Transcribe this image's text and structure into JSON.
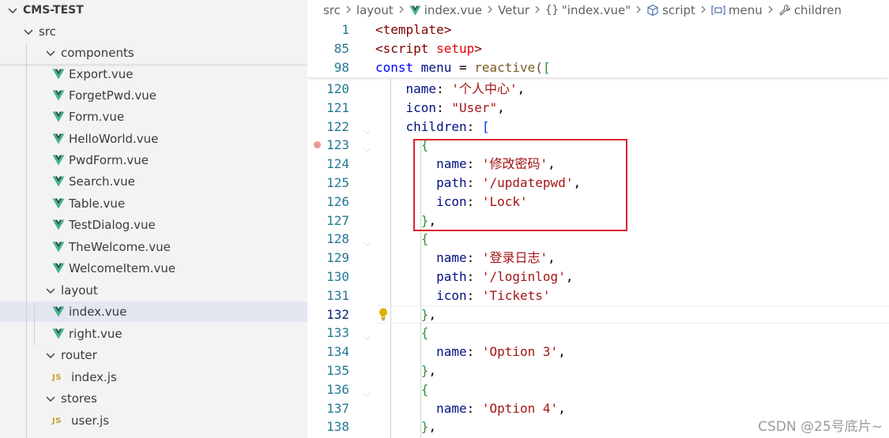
{
  "explorer": {
    "project": "CMS-TEST",
    "items": [
      {
        "label": "src",
        "type": "folder"
      },
      {
        "label": "components",
        "type": "folder"
      },
      {
        "label": "Export.vue",
        "type": "vue"
      },
      {
        "label": "ForgetPwd.vue",
        "type": "vue"
      },
      {
        "label": "Form.vue",
        "type": "vue"
      },
      {
        "label": "HelloWorld.vue",
        "type": "vue"
      },
      {
        "label": "PwdForm.vue",
        "type": "vue"
      },
      {
        "label": "Search.vue",
        "type": "vue"
      },
      {
        "label": "Table.vue",
        "type": "vue"
      },
      {
        "label": "TestDialog.vue",
        "type": "vue"
      },
      {
        "label": "TheWelcome.vue",
        "type": "vue"
      },
      {
        "label": "WelcomeItem.vue",
        "type": "vue"
      },
      {
        "label": "layout",
        "type": "folder"
      },
      {
        "label": "index.vue",
        "type": "vue",
        "selected": true
      },
      {
        "label": "right.vue",
        "type": "vue"
      },
      {
        "label": "router",
        "type": "folder"
      },
      {
        "label": "index.js",
        "type": "js"
      },
      {
        "label": "stores",
        "type": "folder"
      },
      {
        "label": "user.js",
        "type": "js"
      }
    ],
    "js_badge": "JS"
  },
  "breadcrumb": {
    "items": [
      "src",
      "layout",
      "index.vue",
      "Vetur",
      "\"index.vue\"",
      "script",
      "menu",
      "children"
    ],
    "braces": "{}"
  },
  "editor": {
    "sticky_lines": [
      {
        "num": "1",
        "tokens": [
          {
            "t": "<template>",
            "c": "tag"
          }
        ]
      },
      {
        "num": "85",
        "tokens": [
          {
            "t": "<script ",
            "c": "tag"
          },
          {
            "t": "setup",
            "c": "attr"
          },
          {
            "t": ">",
            "c": "tag"
          }
        ]
      },
      {
        "num": "98",
        "tokens": [
          {
            "t": "const ",
            "c": "kw"
          },
          {
            "t": "menu",
            "c": "var"
          },
          {
            "t": " = ",
            "c": "punc"
          },
          {
            "t": "reactive",
            "c": "fn"
          },
          {
            "t": "(",
            "c": "br3"
          },
          {
            "t": "[",
            "c": "br1"
          }
        ]
      }
    ],
    "lines": [
      {
        "num": "120",
        "tokens": [
          {
            "t": "    name",
            "c": "key"
          },
          {
            "t": ": ",
            "c": "punc"
          },
          {
            "t": "'个人中心'",
            "c": "str"
          },
          {
            "t": ",",
            "c": "punc"
          }
        ]
      },
      {
        "num": "121",
        "tokens": [
          {
            "t": "    icon",
            "c": "key"
          },
          {
            "t": ": ",
            "c": "punc"
          },
          {
            "t": "\"User\"",
            "c": "str"
          },
          {
            "t": ",",
            "c": "punc"
          }
        ]
      },
      {
        "num": "122",
        "tokens": [
          {
            "t": "    children",
            "c": "key"
          },
          {
            "t": ": ",
            "c": "punc"
          },
          {
            "t": "[",
            "c": "br2"
          }
        ]
      },
      {
        "num": "123",
        "tokens": [
          {
            "t": "      {",
            "c": "br1"
          }
        ]
      },
      {
        "num": "124",
        "tokens": [
          {
            "t": "        name",
            "c": "key"
          },
          {
            "t": ": ",
            "c": "punc"
          },
          {
            "t": "'修改密码'",
            "c": "str"
          },
          {
            "t": ",",
            "c": "punc"
          }
        ]
      },
      {
        "num": "125",
        "tokens": [
          {
            "t": "        path",
            "c": "key"
          },
          {
            "t": ": ",
            "c": "punc"
          },
          {
            "t": "'/updatepwd'",
            "c": "str"
          },
          {
            "t": ",",
            "c": "punc"
          }
        ]
      },
      {
        "num": "126",
        "tokens": [
          {
            "t": "        icon",
            "c": "key"
          },
          {
            "t": ": ",
            "c": "punc"
          },
          {
            "t": "'Lock'",
            "c": "str"
          }
        ]
      },
      {
        "num": "127",
        "tokens": [
          {
            "t": "      }",
            "c": "br1"
          },
          {
            "t": ",",
            "c": "punc"
          }
        ]
      },
      {
        "num": "128",
        "tokens": [
          {
            "t": "      {",
            "c": "br1"
          }
        ]
      },
      {
        "num": "129",
        "tokens": [
          {
            "t": "        name",
            "c": "key"
          },
          {
            "t": ": ",
            "c": "punc"
          },
          {
            "t": "'登录日志'",
            "c": "str"
          },
          {
            "t": ",",
            "c": "punc"
          }
        ]
      },
      {
        "num": "130",
        "tokens": [
          {
            "t": "        path",
            "c": "key"
          },
          {
            "t": ": ",
            "c": "punc"
          },
          {
            "t": "'/loginlog'",
            "c": "str"
          },
          {
            "t": ",",
            "c": "punc"
          }
        ]
      },
      {
        "num": "131",
        "tokens": [
          {
            "t": "        icon",
            "c": "key"
          },
          {
            "t": ": ",
            "c": "punc"
          },
          {
            "t": "'Tickets'",
            "c": "str"
          }
        ]
      },
      {
        "num": "132",
        "tokens": [
          {
            "t": "      }",
            "c": "br1"
          },
          {
            "t": ",",
            "c": "punc"
          }
        ],
        "active": true
      },
      {
        "num": "133",
        "tokens": [
          {
            "t": "      {",
            "c": "br1"
          }
        ]
      },
      {
        "num": "134",
        "tokens": [
          {
            "t": "        name",
            "c": "key"
          },
          {
            "t": ": ",
            "c": "punc"
          },
          {
            "t": "'Option 3'",
            "c": "str"
          },
          {
            "t": ",",
            "c": "punc"
          }
        ]
      },
      {
        "num": "135",
        "tokens": [
          {
            "t": "      }",
            "c": "br1"
          },
          {
            "t": ",",
            "c": "punc"
          }
        ]
      },
      {
        "num": "136",
        "tokens": [
          {
            "t": "      {",
            "c": "br1"
          }
        ]
      },
      {
        "num": "137",
        "tokens": [
          {
            "t": "        name",
            "c": "key"
          },
          {
            "t": ": ",
            "c": "punc"
          },
          {
            "t": "'Option 4'",
            "c": "str"
          },
          {
            "t": ",",
            "c": "punc"
          }
        ]
      },
      {
        "num": "138",
        "tokens": [
          {
            "t": "      }",
            "c": "br1"
          },
          {
            "t": ",",
            "c": "punc"
          }
        ]
      }
    ]
  },
  "colors": {
    "vue_green": "#41b883",
    "vue_dark": "#34495e",
    "highlight": "#d9232d",
    "breakpoint": "#e89b96",
    "line_number": "#237893"
  },
  "watermark": "CSDN @25号底片~"
}
